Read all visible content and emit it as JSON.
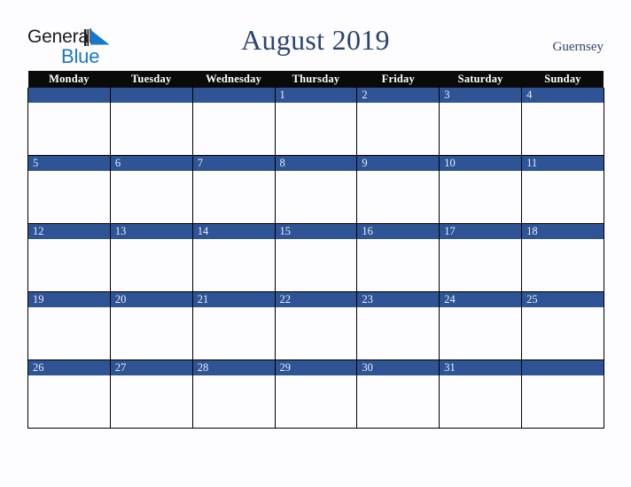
{
  "brand": {
    "line1": "General",
    "line2": "Blue",
    "triangle_color": "#1878c8",
    "line1_color": "#1c1c1c",
    "line2_color": "#1878c8"
  },
  "header": {
    "title": "August 2019",
    "location": "Guernsey",
    "title_color": "#2d4470",
    "location_color": "#2d4470"
  },
  "calendar": {
    "weekday_headers": [
      "Monday",
      "Tuesday",
      "Wednesday",
      "Thursday",
      "Friday",
      "Saturday",
      "Sunday"
    ],
    "header_bg": "#0a0a0a",
    "header_text_color": "#ffffff",
    "date_bar_color": "#2f5496",
    "date_text_color": "#e8ecf5",
    "cell_bg": "#fdfdff",
    "grid_line_color": "#000000",
    "weeks": [
      [
        "",
        "",
        "",
        "1",
        "2",
        "3",
        "4"
      ],
      [
        "5",
        "6",
        "7",
        "8",
        "9",
        "10",
        "11"
      ],
      [
        "12",
        "13",
        "14",
        "15",
        "16",
        "17",
        "18"
      ],
      [
        "19",
        "20",
        "21",
        "22",
        "23",
        "24",
        "25"
      ],
      [
        "26",
        "27",
        "28",
        "29",
        "30",
        "31",
        ""
      ]
    ]
  }
}
